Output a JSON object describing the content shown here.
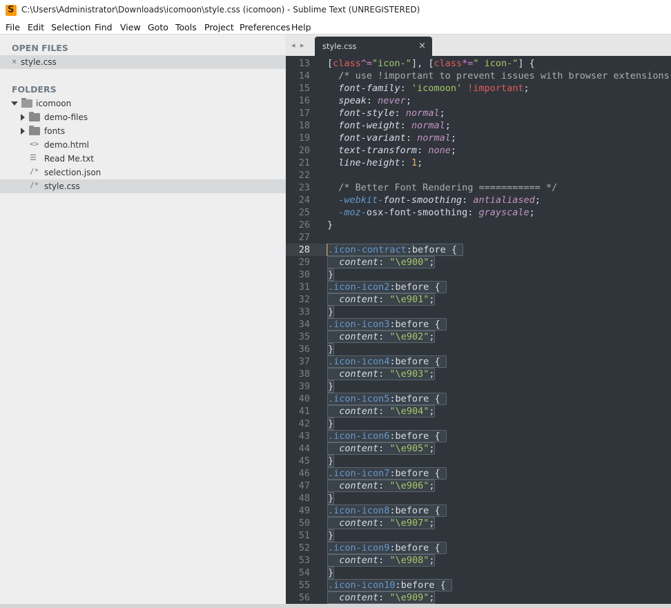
{
  "window": {
    "title": "C:\\Users\\Administrator\\Downloads\\icomoon\\style.css (icomoon) - Sublime Text (UNREGISTERED)",
    "app_icon_glyph": "S"
  },
  "menu": [
    "File",
    "Edit",
    "Selection",
    "Find",
    "View",
    "Goto",
    "Tools",
    "Project",
    "Preferences",
    "Help"
  ],
  "sidebar": {
    "open_files_header": "OPEN FILES",
    "open_files": [
      {
        "name": "style.css",
        "close": "×"
      }
    ],
    "folders_header": "FOLDERS",
    "root_folder": "icomoon",
    "items": [
      {
        "name": "demo-files",
        "kind": "folder"
      },
      {
        "name": "fonts",
        "kind": "folder"
      },
      {
        "name": "demo.html",
        "kind": "file",
        "glyph": "<>"
      },
      {
        "name": "Read Me.txt",
        "kind": "file",
        "glyph": "☰"
      },
      {
        "name": "selection.json",
        "kind": "file",
        "glyph": "/*"
      },
      {
        "name": "style.css",
        "kind": "file",
        "glyph": "/*"
      }
    ]
  },
  "tabs": {
    "nav": "◂ ▸",
    "active": {
      "label": "style.css",
      "close": "×"
    }
  },
  "editor": {
    "current_line": "28",
    "accent_color": "#e5a644",
    "lines": [
      {
        "n": "13",
        "tokens": [
          [
            "c-punct",
            "["
          ],
          [
            "c-kw",
            "class"
          ],
          [
            "c-op",
            "^="
          ],
          [
            "c-str",
            "\"icon-\""
          ],
          [
            "c-punct",
            "], ["
          ],
          [
            "c-kw",
            "class"
          ],
          [
            "c-op",
            "*="
          ],
          [
            "c-str",
            "\" icon-\""
          ],
          [
            "c-punct",
            "] {"
          ]
        ]
      },
      {
        "n": "14",
        "tokens": [
          [
            "c-comment",
            "  /* use !important to prevent issues with browser extensions"
          ]
        ]
      },
      {
        "n": "15",
        "tokens": [
          [
            "c-punct",
            "  "
          ],
          [
            "c-prop",
            "font-family"
          ],
          [
            "c-punct",
            ": "
          ],
          [
            "c-str",
            "'icomoon'"
          ],
          [
            "c-punct",
            " "
          ],
          [
            "c-kw",
            "!important"
          ],
          [
            "c-punct",
            ";"
          ]
        ]
      },
      {
        "n": "16",
        "tokens": [
          [
            "c-punct",
            "  "
          ],
          [
            "c-prop",
            "speak"
          ],
          [
            "c-punct",
            ": "
          ],
          [
            "c-val",
            "never"
          ],
          [
            "c-punct",
            ";"
          ]
        ]
      },
      {
        "n": "17",
        "tokens": [
          [
            "c-punct",
            "  "
          ],
          [
            "c-prop",
            "font-style"
          ],
          [
            "c-punct",
            ": "
          ],
          [
            "c-val",
            "normal"
          ],
          [
            "c-punct",
            ";"
          ]
        ]
      },
      {
        "n": "18",
        "tokens": [
          [
            "c-punct",
            "  "
          ],
          [
            "c-prop",
            "font-weight"
          ],
          [
            "c-punct",
            ": "
          ],
          [
            "c-val",
            "normal"
          ],
          [
            "c-punct",
            ";"
          ]
        ]
      },
      {
        "n": "19",
        "tokens": [
          [
            "c-punct",
            "  "
          ],
          [
            "c-prop",
            "font-variant"
          ],
          [
            "c-punct",
            ": "
          ],
          [
            "c-val",
            "normal"
          ],
          [
            "c-punct",
            ";"
          ]
        ]
      },
      {
        "n": "20",
        "tokens": [
          [
            "c-punct",
            "  "
          ],
          [
            "c-prop",
            "text-transform"
          ],
          [
            "c-punct",
            ": "
          ],
          [
            "c-val",
            "none"
          ],
          [
            "c-punct",
            ";"
          ]
        ]
      },
      {
        "n": "21",
        "tokens": [
          [
            "c-punct",
            "  "
          ],
          [
            "c-prop",
            "line-height"
          ],
          [
            "c-punct",
            ": "
          ],
          [
            "c-num",
            "1"
          ],
          [
            "c-punct",
            ";"
          ]
        ]
      },
      {
        "n": "22",
        "tokens": []
      },
      {
        "n": "23",
        "tokens": [
          [
            "c-comment",
            "  /* Better Font Rendering =========== */"
          ]
        ]
      },
      {
        "n": "24",
        "tokens": [
          [
            "c-punct",
            "  "
          ],
          [
            "c-vendor",
            "-webkit-"
          ],
          [
            "c-prop",
            "font-smoothing"
          ],
          [
            "c-punct",
            ": "
          ],
          [
            "c-val",
            "antialiased"
          ],
          [
            "c-punct",
            ";"
          ]
        ]
      },
      {
        "n": "25",
        "tokens": [
          [
            "c-punct",
            "  "
          ],
          [
            "c-vendor",
            "-moz-"
          ],
          [
            "c-punct",
            "osx-font-smoothing: "
          ],
          [
            "c-val",
            "grayscale"
          ],
          [
            "c-punct",
            ";"
          ]
        ]
      },
      {
        "n": "26",
        "tokens": [
          [
            "c-punct",
            "}"
          ]
        ]
      },
      {
        "n": "27",
        "tokens": []
      },
      {
        "n": "28",
        "hl": true,
        "tokens": [
          [
            "c-sel",
            ".icon-contract"
          ],
          [
            "c-punct",
            ":"
          ],
          [
            "c-pseudo",
            "before"
          ],
          [
            "c-punct",
            " { "
          ]
        ]
      },
      {
        "n": "29",
        "hl": true,
        "tokens": [
          [
            "c-punct",
            "  "
          ],
          [
            "c-prop",
            "content"
          ],
          [
            "c-punct",
            ": "
          ],
          [
            "c-str",
            "\"\\e900\""
          ],
          [
            "c-punct",
            ";"
          ]
        ]
      },
      {
        "n": "30",
        "hl": true,
        "tokens": [
          [
            "c-punct",
            "}"
          ]
        ]
      },
      {
        "n": "31",
        "hl": true,
        "tokens": [
          [
            "c-sel",
            ".icon-icon2"
          ],
          [
            "c-punct",
            ":"
          ],
          [
            "c-pseudo",
            "before"
          ],
          [
            "c-punct",
            " { "
          ]
        ]
      },
      {
        "n": "32",
        "hl": true,
        "tokens": [
          [
            "c-punct",
            "  "
          ],
          [
            "c-prop",
            "content"
          ],
          [
            "c-punct",
            ": "
          ],
          [
            "c-str",
            "\"\\e901\""
          ],
          [
            "c-punct",
            ";"
          ]
        ]
      },
      {
        "n": "33",
        "hl": true,
        "tokens": [
          [
            "c-punct",
            "}"
          ]
        ]
      },
      {
        "n": "34",
        "hl": true,
        "tokens": [
          [
            "c-sel",
            ".icon-icon3"
          ],
          [
            "c-punct",
            ":"
          ],
          [
            "c-pseudo",
            "before"
          ],
          [
            "c-punct",
            " { "
          ]
        ]
      },
      {
        "n": "35",
        "hl": true,
        "tokens": [
          [
            "c-punct",
            "  "
          ],
          [
            "c-prop",
            "content"
          ],
          [
            "c-punct",
            ": "
          ],
          [
            "c-str",
            "\"\\e902\""
          ],
          [
            "c-punct",
            ";"
          ]
        ]
      },
      {
        "n": "36",
        "hl": true,
        "tokens": [
          [
            "c-punct",
            "}"
          ]
        ]
      },
      {
        "n": "37",
        "hl": true,
        "tokens": [
          [
            "c-sel",
            ".icon-icon4"
          ],
          [
            "c-punct",
            ":"
          ],
          [
            "c-pseudo",
            "before"
          ],
          [
            "c-punct",
            " { "
          ]
        ]
      },
      {
        "n": "38",
        "hl": true,
        "tokens": [
          [
            "c-punct",
            "  "
          ],
          [
            "c-prop",
            "content"
          ],
          [
            "c-punct",
            ": "
          ],
          [
            "c-str",
            "\"\\e903\""
          ],
          [
            "c-punct",
            ";"
          ]
        ]
      },
      {
        "n": "39",
        "hl": true,
        "tokens": [
          [
            "c-punct",
            "}"
          ]
        ]
      },
      {
        "n": "40",
        "hl": true,
        "tokens": [
          [
            "c-sel",
            ".icon-icon5"
          ],
          [
            "c-punct",
            ":"
          ],
          [
            "c-pseudo",
            "before"
          ],
          [
            "c-punct",
            " { "
          ]
        ]
      },
      {
        "n": "41",
        "hl": true,
        "tokens": [
          [
            "c-punct",
            "  "
          ],
          [
            "c-prop",
            "content"
          ],
          [
            "c-punct",
            ": "
          ],
          [
            "c-str",
            "\"\\e904\""
          ],
          [
            "c-punct",
            ";"
          ]
        ]
      },
      {
        "n": "42",
        "hl": true,
        "tokens": [
          [
            "c-punct",
            "}"
          ]
        ]
      },
      {
        "n": "43",
        "hl": true,
        "tokens": [
          [
            "c-sel",
            ".icon-icon6"
          ],
          [
            "c-punct",
            ":"
          ],
          [
            "c-pseudo",
            "before"
          ],
          [
            "c-punct",
            " { "
          ]
        ]
      },
      {
        "n": "44",
        "hl": true,
        "tokens": [
          [
            "c-punct",
            "  "
          ],
          [
            "c-prop",
            "content"
          ],
          [
            "c-punct",
            ": "
          ],
          [
            "c-str",
            "\"\\e905\""
          ],
          [
            "c-punct",
            ";"
          ]
        ]
      },
      {
        "n": "45",
        "hl": true,
        "tokens": [
          [
            "c-punct",
            "}"
          ]
        ]
      },
      {
        "n": "46",
        "hl": true,
        "tokens": [
          [
            "c-sel",
            ".icon-icon7"
          ],
          [
            "c-punct",
            ":"
          ],
          [
            "c-pseudo",
            "before"
          ],
          [
            "c-punct",
            " { "
          ]
        ]
      },
      {
        "n": "47",
        "hl": true,
        "tokens": [
          [
            "c-punct",
            "  "
          ],
          [
            "c-prop",
            "content"
          ],
          [
            "c-punct",
            ": "
          ],
          [
            "c-str",
            "\"\\e906\""
          ],
          [
            "c-punct",
            ";"
          ]
        ]
      },
      {
        "n": "48",
        "hl": true,
        "tokens": [
          [
            "c-punct",
            "}"
          ]
        ]
      },
      {
        "n": "49",
        "hl": true,
        "tokens": [
          [
            "c-sel",
            ".icon-icon8"
          ],
          [
            "c-punct",
            ":"
          ],
          [
            "c-pseudo",
            "before"
          ],
          [
            "c-punct",
            " { "
          ]
        ]
      },
      {
        "n": "50",
        "hl": true,
        "tokens": [
          [
            "c-punct",
            "  "
          ],
          [
            "c-prop",
            "content"
          ],
          [
            "c-punct",
            ": "
          ],
          [
            "c-str",
            "\"\\e907\""
          ],
          [
            "c-punct",
            ";"
          ]
        ]
      },
      {
        "n": "51",
        "hl": true,
        "tokens": [
          [
            "c-punct",
            "}"
          ]
        ]
      },
      {
        "n": "52",
        "hl": true,
        "tokens": [
          [
            "c-sel",
            ".icon-icon9"
          ],
          [
            "c-punct",
            ":"
          ],
          [
            "c-pseudo",
            "before"
          ],
          [
            "c-punct",
            " { "
          ]
        ]
      },
      {
        "n": "53",
        "hl": true,
        "tokens": [
          [
            "c-punct",
            "  "
          ],
          [
            "c-prop",
            "content"
          ],
          [
            "c-punct",
            ": "
          ],
          [
            "c-str",
            "\"\\e908\""
          ],
          [
            "c-punct",
            ";"
          ]
        ]
      },
      {
        "n": "54",
        "hl": true,
        "tokens": [
          [
            "c-punct",
            "}"
          ]
        ]
      },
      {
        "n": "55",
        "hl": true,
        "tokens": [
          [
            "c-sel",
            ".icon-icon10"
          ],
          [
            "c-punct",
            ":"
          ],
          [
            "c-pseudo",
            "before"
          ],
          [
            "c-punct",
            " { "
          ]
        ]
      },
      {
        "n": "56",
        "hl": true,
        "tokens": [
          [
            "c-punct",
            "  "
          ],
          [
            "c-prop",
            "content"
          ],
          [
            "c-punct",
            ": "
          ],
          [
            "c-str",
            "\"\\e909\""
          ],
          [
            "c-punct",
            ";"
          ]
        ]
      }
    ]
  }
}
